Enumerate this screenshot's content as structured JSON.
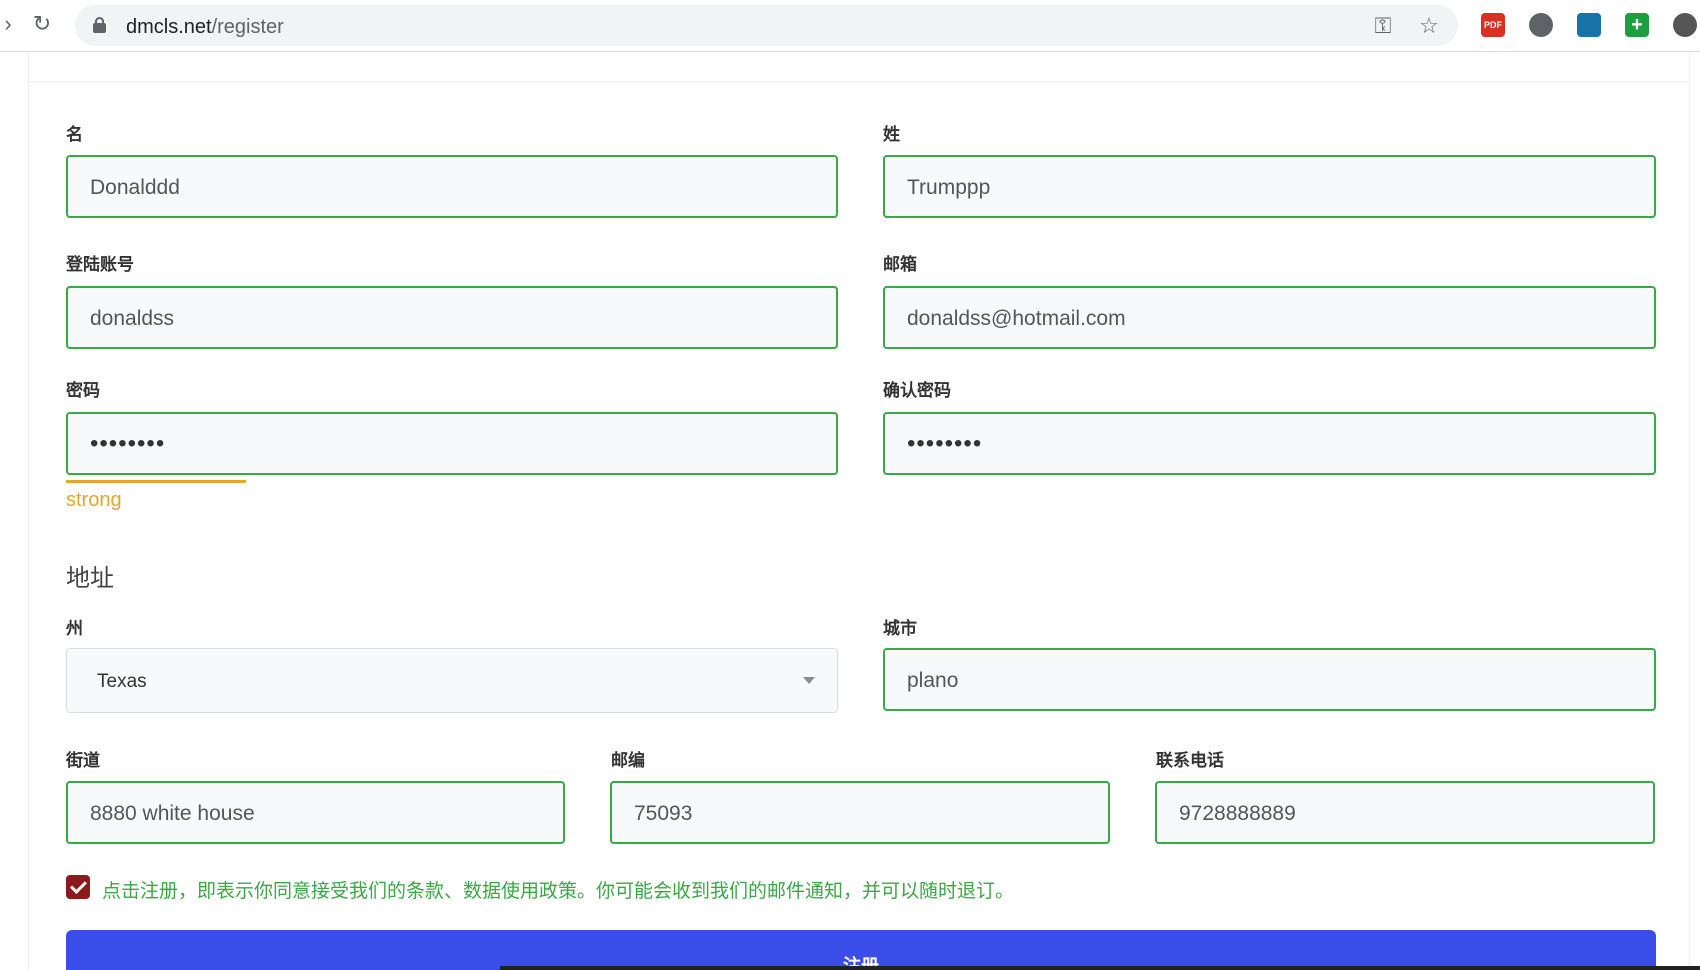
{
  "browser": {
    "url_host": "dmcls.net",
    "url_path": "/register"
  },
  "form": {
    "first_name": {
      "label": "名",
      "value": "Donalddd"
    },
    "last_name": {
      "label": "姓",
      "value": "Trumppp"
    },
    "account": {
      "label": "登陆账号",
      "value": "donaldss"
    },
    "email": {
      "label": "邮箱",
      "value": "donaldss@hotmail.com"
    },
    "password": {
      "label": "密码",
      "value": "••••••••"
    },
    "confirm_password": {
      "label": "确认密码",
      "value": "••••••••"
    },
    "strength": {
      "text": "strong",
      "level": 0.25,
      "color": "#e4a62a"
    }
  },
  "address": {
    "title": "地址",
    "state": {
      "label": "州",
      "value": "Texas"
    },
    "city": {
      "label": "城市",
      "value": "plano"
    },
    "street": {
      "label": "街道",
      "value": "8880 white house"
    },
    "zip": {
      "label": "邮编",
      "value": "75093"
    },
    "phone": {
      "label": "联系电话",
      "value": "9728888889"
    }
  },
  "terms": {
    "checked": true,
    "text": "点击注册，即表示你同意接受我们的条款、数据使用政策。你可能会收到我们的邮件通知，并可以随时退订。"
  },
  "submit_label": "注册",
  "colors": {
    "valid_border": "#3aa845",
    "accent_button": "#3a4de8",
    "checkbox": "#8b1a1a"
  }
}
